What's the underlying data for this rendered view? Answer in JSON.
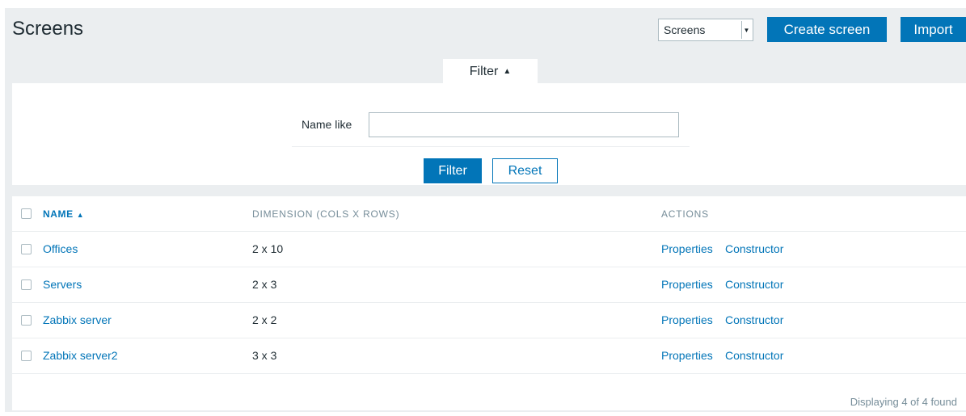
{
  "header": {
    "title": "Screens",
    "select_value": "Screens",
    "create_button": "Create screen",
    "import_button": "Import"
  },
  "filter": {
    "tab_label": "Filter",
    "name_like_label": "Name like",
    "name_like_value": "",
    "filter_button": "Filter",
    "reset_button": "Reset"
  },
  "table": {
    "columns": [
      "NAME",
      "DIMENSION (COLS X ROWS)",
      "ACTIONS"
    ],
    "rows": [
      {
        "name": "Offices",
        "dimension": "2 x 10",
        "properties": "Properties",
        "constructor": "Constructor"
      },
      {
        "name": "Servers",
        "dimension": "2 x 3",
        "properties": "Properties",
        "constructor": "Constructor"
      },
      {
        "name": "Zabbix server",
        "dimension": "2 x 2",
        "properties": "Properties",
        "constructor": "Constructor"
      },
      {
        "name": "Zabbix server2",
        "dimension": "3 x 3",
        "properties": "Properties",
        "constructor": "Constructor"
      }
    ],
    "footer": "Displaying 4 of 4 found"
  },
  "colors": {
    "accent": "#0275b8",
    "background": "#ebeef0",
    "text": "#1f2c33",
    "muted": "#768d99"
  }
}
